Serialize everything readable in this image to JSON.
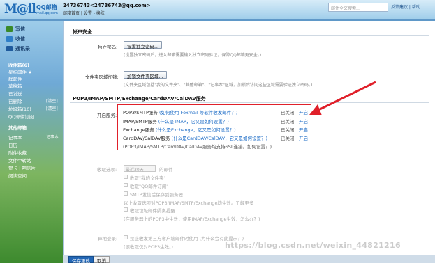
{
  "header": {
    "logo_big": "M@il",
    "logo_cn": "QQ邮箱",
    "logo_url": "mail.qq.com",
    "user": "24736743<24736743@qq.com>",
    "user_links": "邮箱首页 | 设置 - 换肤",
    "search_placeholder": "邮件全文搜索…",
    "top_links": "反馈建议 | 帮助"
  },
  "sidebar": {
    "write": "写信",
    "receive": "收信",
    "contacts": "通讯录",
    "folders": [
      {
        "label": "收件箱(6)",
        "bold": true
      },
      {
        "label": "星标邮件 ★",
        "bold": false
      },
      {
        "label": "群邮件",
        "bold": false
      },
      {
        "label": "草稿箱",
        "bold": false
      },
      {
        "label": "已发送",
        "bold": false
      },
      {
        "label": "已删除",
        "bold": false
      },
      {
        "label": "垃圾箱(10)",
        "bold": false
      },
      {
        "label": "QQ邮件订阅",
        "bold": false
      }
    ],
    "folder_right": [
      "[清空]",
      "[清空]"
    ],
    "other_title": "其他邮箱",
    "other_items": [
      "记事本",
      "日历",
      "附件收藏",
      "文件中转站",
      "贺卡 | 明信片",
      "阅读空间"
    ],
    "other_right": [
      "记事本"
    ]
  },
  "account_section": {
    "title": "帐户安全",
    "pwd_label": "独立密码:",
    "pwd_button": "设置独立密码...",
    "pwd_note": "(设置独立密码后，进入邮箱需要输入独立密码验证，保障QQ邮箱更安全。)",
    "folder_label": "文件夹区域加锁:",
    "folder_button": "加锁文件夹区域...",
    "folder_note": "(文件夹区域包括\"我的文件夹\"、\"其他邮箱\"、\"记事本\"区域，加锁后访问这些区域需要验证独立密码。)"
  },
  "pop_section": {
    "title": "POP3/IMAP/SMTP/Exchange/CardDAV/CalDAV服务",
    "label": "开启服务:",
    "services": [
      {
        "name": "POP3/SMTP服务",
        "hint": "(如何使用 Foxmail 等软件收发邮件？)",
        "status": "已关闭",
        "action": "开启"
      },
      {
        "name": "IMAP/SMTP服务",
        "hint": "(什么是 IMAP，它又是如何设置？)",
        "status": "已关闭",
        "action": "开启"
      },
      {
        "name": "Exchange服务",
        "hint": "(什么是Exchange，它又是如何设置？)",
        "status": "已关闭",
        "action": "开启"
      },
      {
        "name": "CardDAV/CalDAV服务",
        "hint": "(什么是CardDAV/CalDAV，它又是如何设置？)",
        "status": "已关闭",
        "action": "开启"
      }
    ],
    "footer": "(POP3/IMAP/SMTP/CardDAV/CalDAV服务均支持SSL连接。如何设置？)"
  },
  "receive_section": {
    "label": "收取选项:",
    "select": "最近30天",
    "select_suffix": "的邮件",
    "options": [
      "收取\"我的文件夹\"",
      "收取\"QQ邮件订阅\"",
      "SMTP发信后保存到服务器",
      "以上收取选项对POP3/IMAP/SMTP/Exchange均生效。了解更多",
      "收取垃圾邮件隔离提醒",
      "(在服务器上的POP3中生效，使用IMAP/Exchange生效，怎么办？)"
    ]
  },
  "protect_section": {
    "label": "异地登录:",
    "options": [
      "禁止收发第三方客户端邮件时使用 (为什么会有此提示？)",
      "(该收取仅对POP3生效。)"
    ]
  },
  "footer": {
    "save": "保存更改",
    "cancel": "取消"
  },
  "watermark": "https://blog.csdn.net/weixin_44821216",
  "colors": {
    "accent": "#1b6bc6",
    "highlight_border": "#e0202a"
  }
}
